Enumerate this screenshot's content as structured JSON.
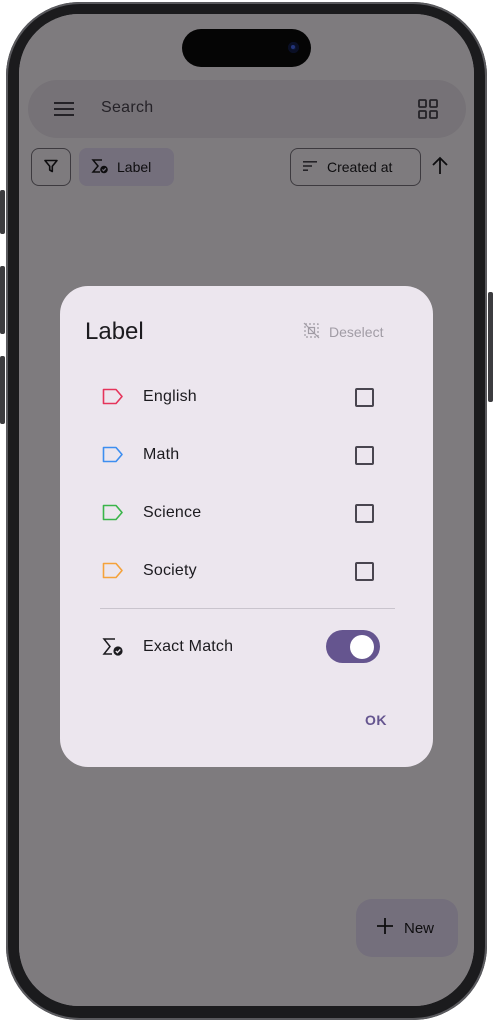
{
  "search": {
    "placeholder": "Search"
  },
  "chips": {
    "label": "Label",
    "sort": "Created at"
  },
  "fab": {
    "label": "New"
  },
  "dialog": {
    "title": "Label",
    "deselect": "Deselect",
    "labels": [
      {
        "name": "English",
        "color": "#e5345b",
        "checked": false
      },
      {
        "name": "Math",
        "color": "#3d8ef0",
        "checked": false
      },
      {
        "name": "Science",
        "color": "#3ab54a",
        "checked": false
      },
      {
        "name": "Society",
        "color": "#f5a23a",
        "checked": false
      }
    ],
    "exact_match": {
      "label": "Exact Match",
      "on": true
    },
    "ok": "OK"
  },
  "colors": {
    "accent": "#65558f",
    "chip_bg": "#e8def8",
    "dialog_bg": "#ece6ee"
  }
}
